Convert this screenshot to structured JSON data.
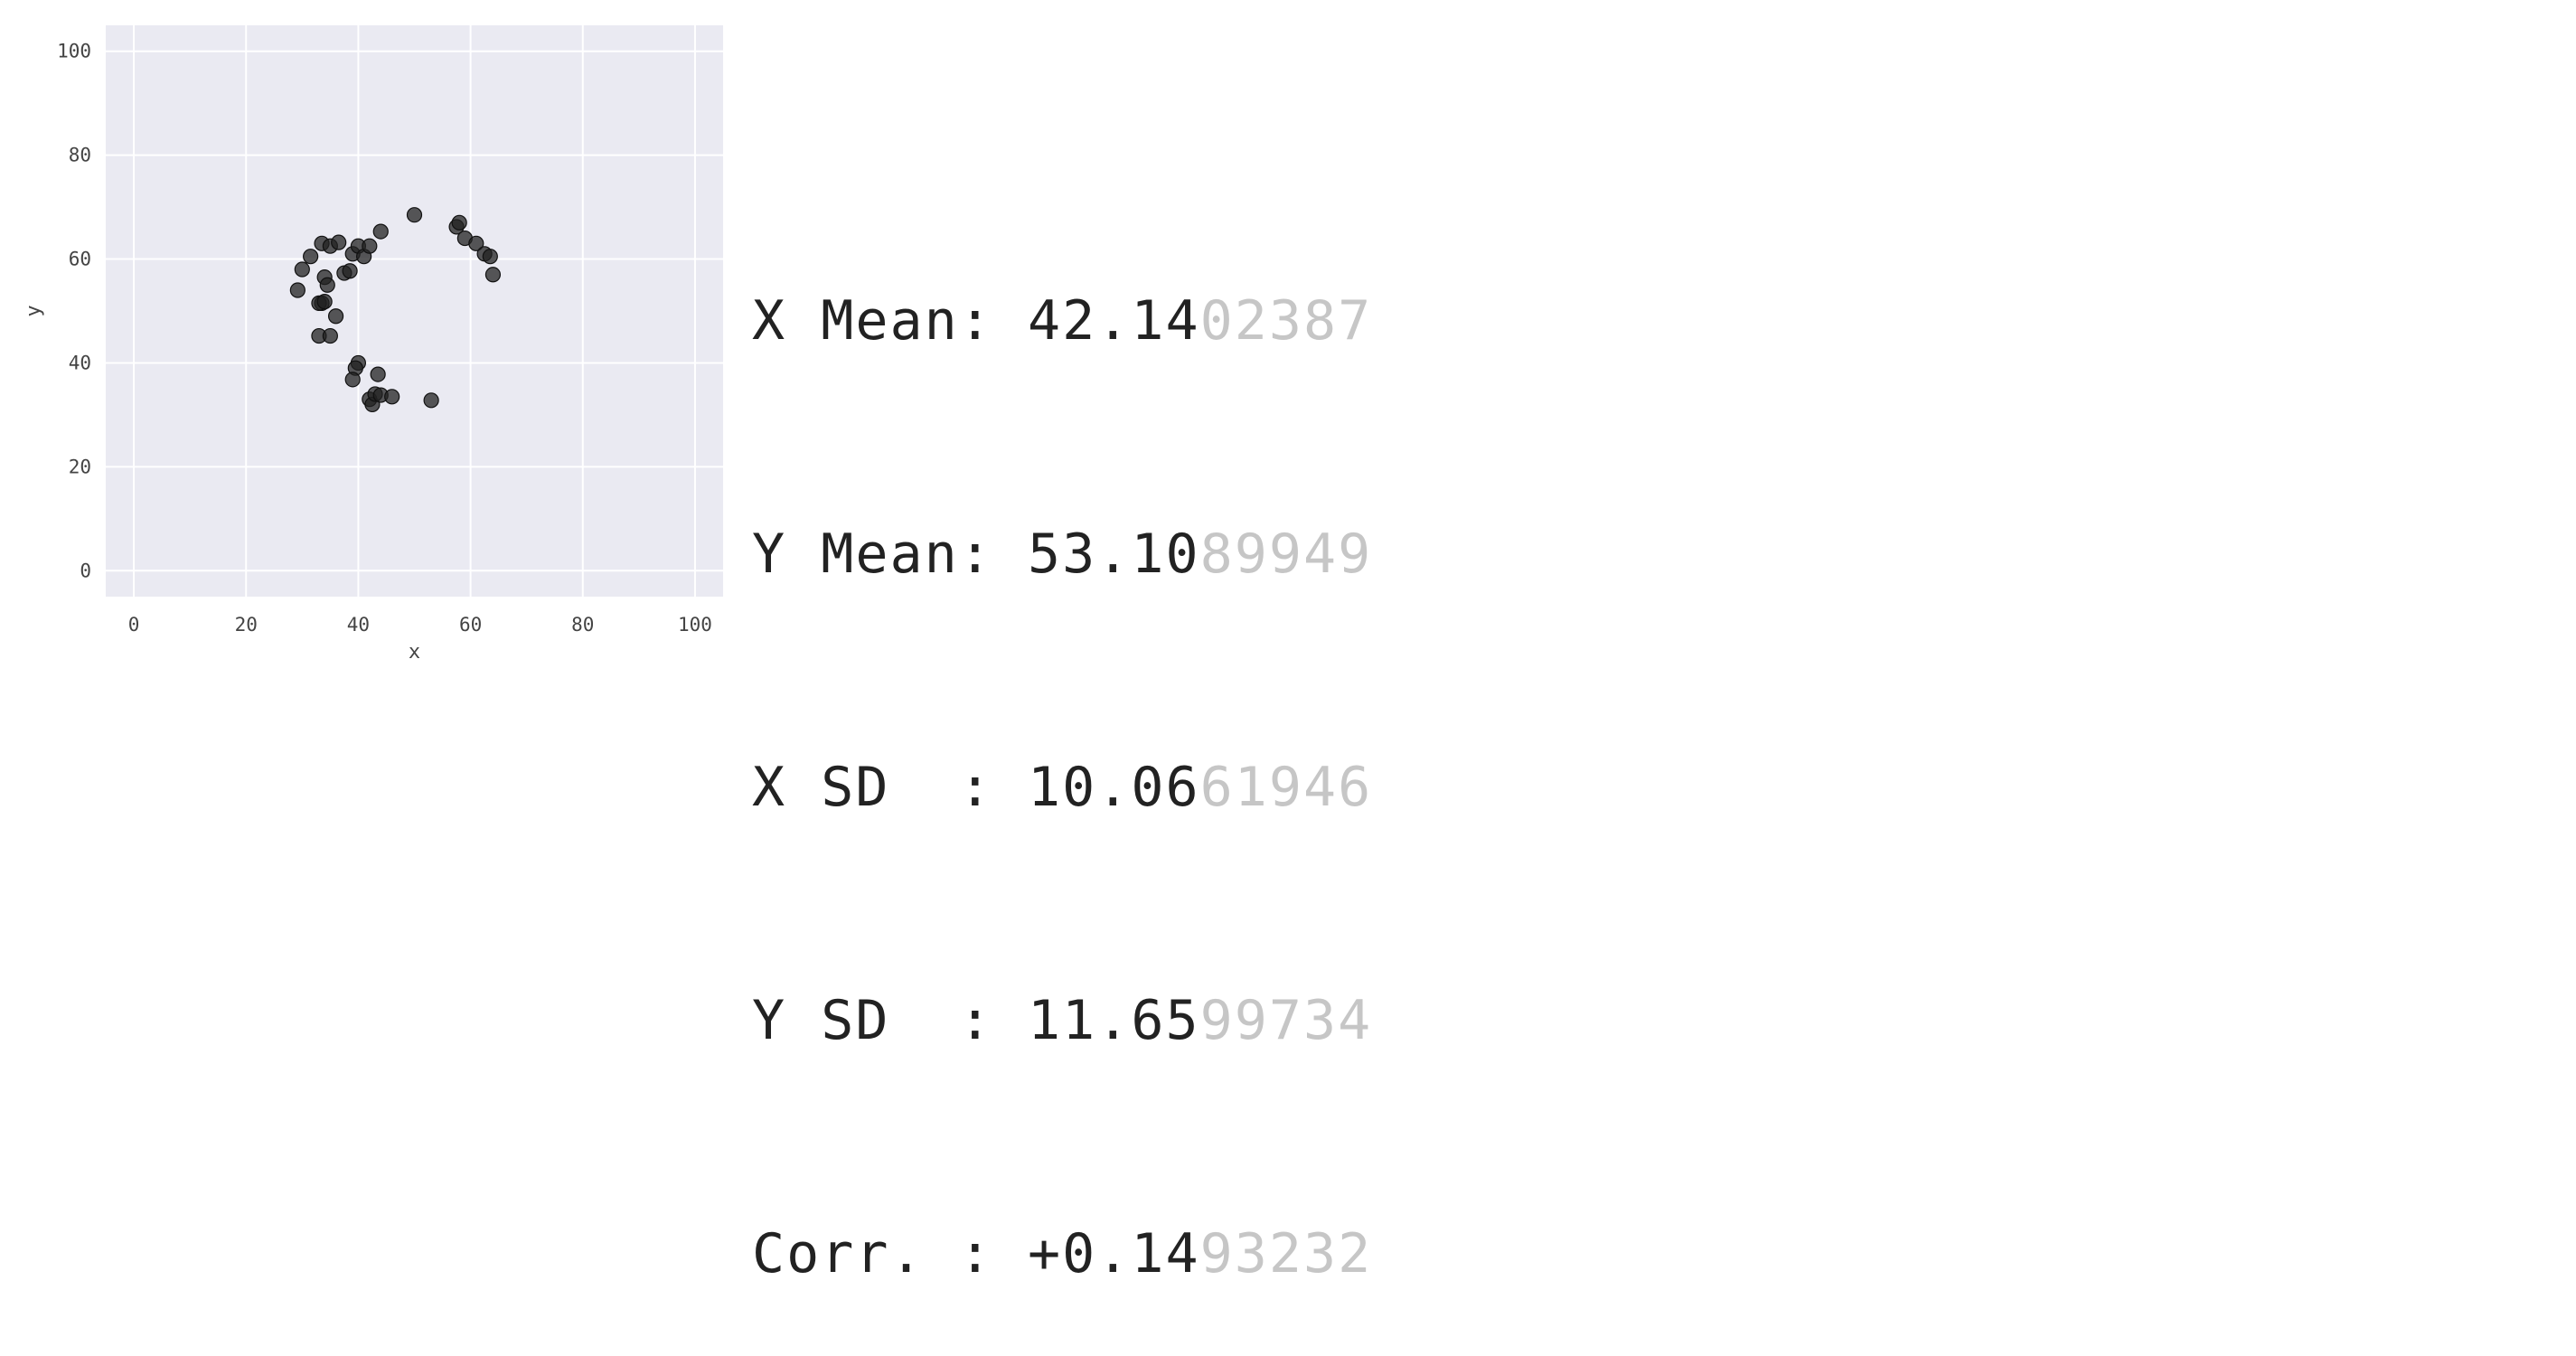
{
  "chart_data": {
    "type": "scatter",
    "xlabel": "x",
    "ylabel": "y",
    "xlim": [
      -5,
      105
    ],
    "ylim": [
      -5,
      105
    ],
    "xticks": [
      0,
      20,
      40,
      60,
      80,
      100
    ],
    "yticks": [
      0,
      20,
      40,
      60,
      80,
      100
    ],
    "grid": true,
    "background_color": "#eaeaf2",
    "point_color": "#222222",
    "x": [
      29.2,
      30.0,
      31.5,
      33.5,
      35.0,
      36.5,
      34.0,
      33.5,
      34.5,
      33.0,
      34.0,
      36.0,
      33.0,
      35.0,
      37.5,
      38.5,
      39.0,
      40.0,
      41.0,
      42.0,
      44.0,
      50.0,
      57.5,
      58.0,
      59.0,
      61.0,
      62.5,
      63.5,
      64.0,
      40.0,
      39.5,
      39.0,
      43.5,
      42.0,
      42.5,
      43.0,
      44.0,
      46.0,
      53.0
    ],
    "y": [
      54.0,
      58.0,
      60.5,
      63.0,
      62.5,
      63.2,
      56.5,
      51.5,
      55.0,
      51.5,
      51.8,
      49.0,
      45.2,
      45.2,
      57.3,
      57.7,
      61.0,
      62.5,
      60.5,
      62.5,
      65.3,
      68.5,
      66.2,
      67.0,
      64.0,
      63.0,
      61.0,
      60.5,
      57.0,
      40.0,
      39.0,
      36.8,
      37.8,
      33.0,
      32.0,
      34.0,
      33.8,
      33.5,
      32.8
    ]
  },
  "stats": [
    {
      "label": "X Mean: ",
      "value": "42.14",
      "faded": "02387"
    },
    {
      "label": "Y Mean: ",
      "value": "53.10",
      "faded": "89949"
    },
    {
      "label": "X SD  : ",
      "value": "10.06",
      "faded": "61946"
    },
    {
      "label": "Y SD  : ",
      "value": "11.65",
      "faded": "99734"
    },
    {
      "label": "Corr. : ",
      "value": "+0.14",
      "faded": "93232"
    }
  ]
}
